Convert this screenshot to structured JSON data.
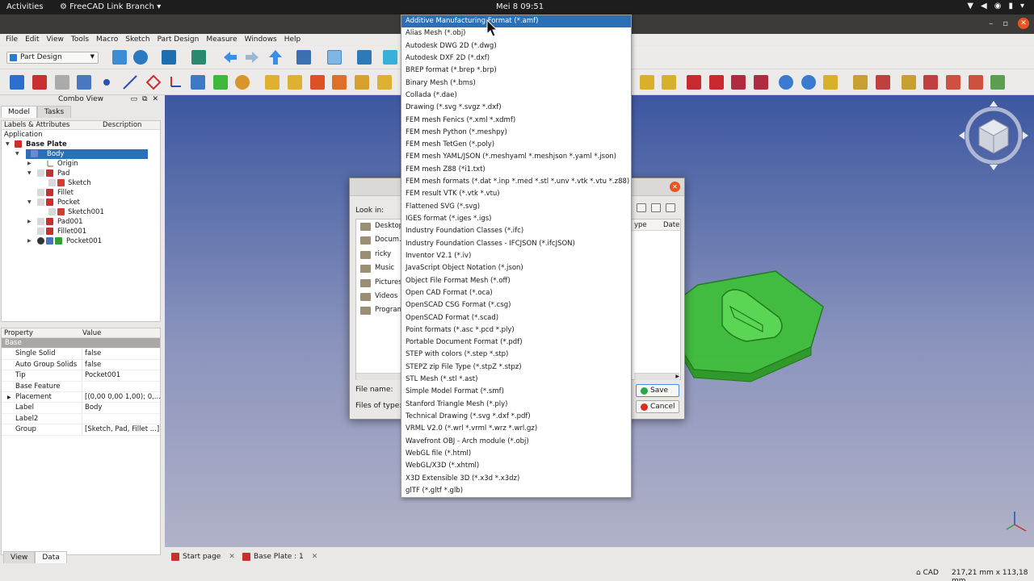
{
  "topbar": {
    "activities": "Activities",
    "app_name": "FreeCAD Link Branch",
    "app_arrow": "▾",
    "clock": "Mei 8  09:51"
  },
  "menubar": {
    "items": [
      "File",
      "Edit",
      "View",
      "Tools",
      "Macro",
      "Sketch",
      "Part Design",
      "Measure",
      "Windows",
      "Help"
    ]
  },
  "workbench": {
    "selected": "Part Design"
  },
  "combo": {
    "title": "Combo View",
    "tabs": [
      "Model",
      "Tasks"
    ],
    "tree_columns": [
      "Labels & Attributes",
      "Description"
    ],
    "tree_rows": [
      "Application",
      "Base Plate",
      "Body",
      "Origin",
      "Pad",
      "Sketch",
      "Fillet",
      "Pocket",
      "Sketch001",
      "Pad001",
      "Fillet001",
      "Pocket001"
    ]
  },
  "properties": {
    "columns": [
      "Property",
      "Value"
    ],
    "group": "Base",
    "rows": [
      {
        "name": "Single Solid",
        "value": "false"
      },
      {
        "name": "Auto Group Solids",
        "value": "false"
      },
      {
        "name": "Tip",
        "value": "Pocket001"
      },
      {
        "name": "Base Feature",
        "value": ""
      },
      {
        "name": "Placement",
        "value": "[(0,00 0,00 1,00); 0,..."
      },
      {
        "name": "Label",
        "value": "Body"
      },
      {
        "name": "Label2",
        "value": ""
      },
      {
        "name": "Group",
        "value": "[Sketch, Pad, Fillet ...]"
      }
    ],
    "view_tabs": [
      "View",
      "Data"
    ]
  },
  "doc_tabs": [
    "Start page",
    "Base Plate : 1"
  ],
  "status": {
    "nav_style": "CAD",
    "dimensions": "217,21 mm x 113,18 mm"
  },
  "dialog": {
    "look_in": "Look in:",
    "places": [
      "Desktop",
      "Docum...",
      "ricky",
      "Music",
      "Pictures",
      "Videos",
      "Program..."
    ],
    "file_columns": [
      "ype",
      "Date"
    ],
    "file_name_label": "File name:",
    "files_of_type_label": "Files of type:",
    "save_button": "Save",
    "cancel_button": "Cancel"
  },
  "dropdown": {
    "selected_index": 0,
    "options": [
      "Additive Manufacturing Format (*.amf)",
      "Alias Mesh (*.obj)",
      "Autodesk DWG 2D (*.dwg)",
      "Autodesk DXF 2D (*.dxf)",
      "BREP format (*.brep *.brp)",
      "Binary Mesh (*.bms)",
      "Collada (*.dae)",
      "Drawing (*.svg *.svgz *.dxf)",
      "FEM mesh Fenics (*.xml *.xdmf)",
      "FEM mesh Python (*.meshpy)",
      "FEM mesh TetGen (*.poly)",
      "FEM mesh YAML/JSON (*.meshyaml *.meshjson *.yaml *.json)",
      "FEM mesh Z88 (*i1.txt)",
      "FEM mesh formats (*.dat *.inp *.med *.stl *.unv *.vtk *.vtu *.z88)",
      "FEM result VTK (*.vtk *.vtu)",
      "Flattened SVG (*.svg)",
      "IGES format (*.iges *.igs)",
      "Industry Foundation Classes (*.ifc)",
      "Industry Foundation Classes - IFCJSON (*.ifcJSON)",
      "Inventor V2.1 (*.iv)",
      "JavaScript Object Notation (*.json)",
      "Object File Format Mesh (*.off)",
      "Open CAD Format (*.oca)",
      "OpenSCAD CSG Format (*.csg)",
      "OpenSCAD Format (*.scad)",
      "Point formats (*.asc *.pcd *.ply)",
      "Portable Document Format (*.pdf)",
      "STEP with colors (*.step *.stp)",
      "STEPZ zip File Type (*.stpZ *.stpz)",
      "STL Mesh (*.stl *.ast)",
      "Simple Model Format (*.smf)",
      "Stanford Triangle Mesh (*.ply)",
      "Technical Drawing (*.svg *.dxf *.pdf)",
      "VRML V2.0 (*.wrl *.vrml *.wrz *.wrl.gz)",
      "Wavefront OBJ - Arch module (*.obj)",
      "WebGL file (*.html)",
      "WebGL/X3D (*.xhtml)",
      "X3D Extensible 3D (*.x3d *.x3dz)",
      "glTF (*.gltf *.glb)"
    ]
  },
  "colors": {
    "selection": "#2b6fb5",
    "model_green": "#3ec83a",
    "close_orange": "#e95420"
  }
}
